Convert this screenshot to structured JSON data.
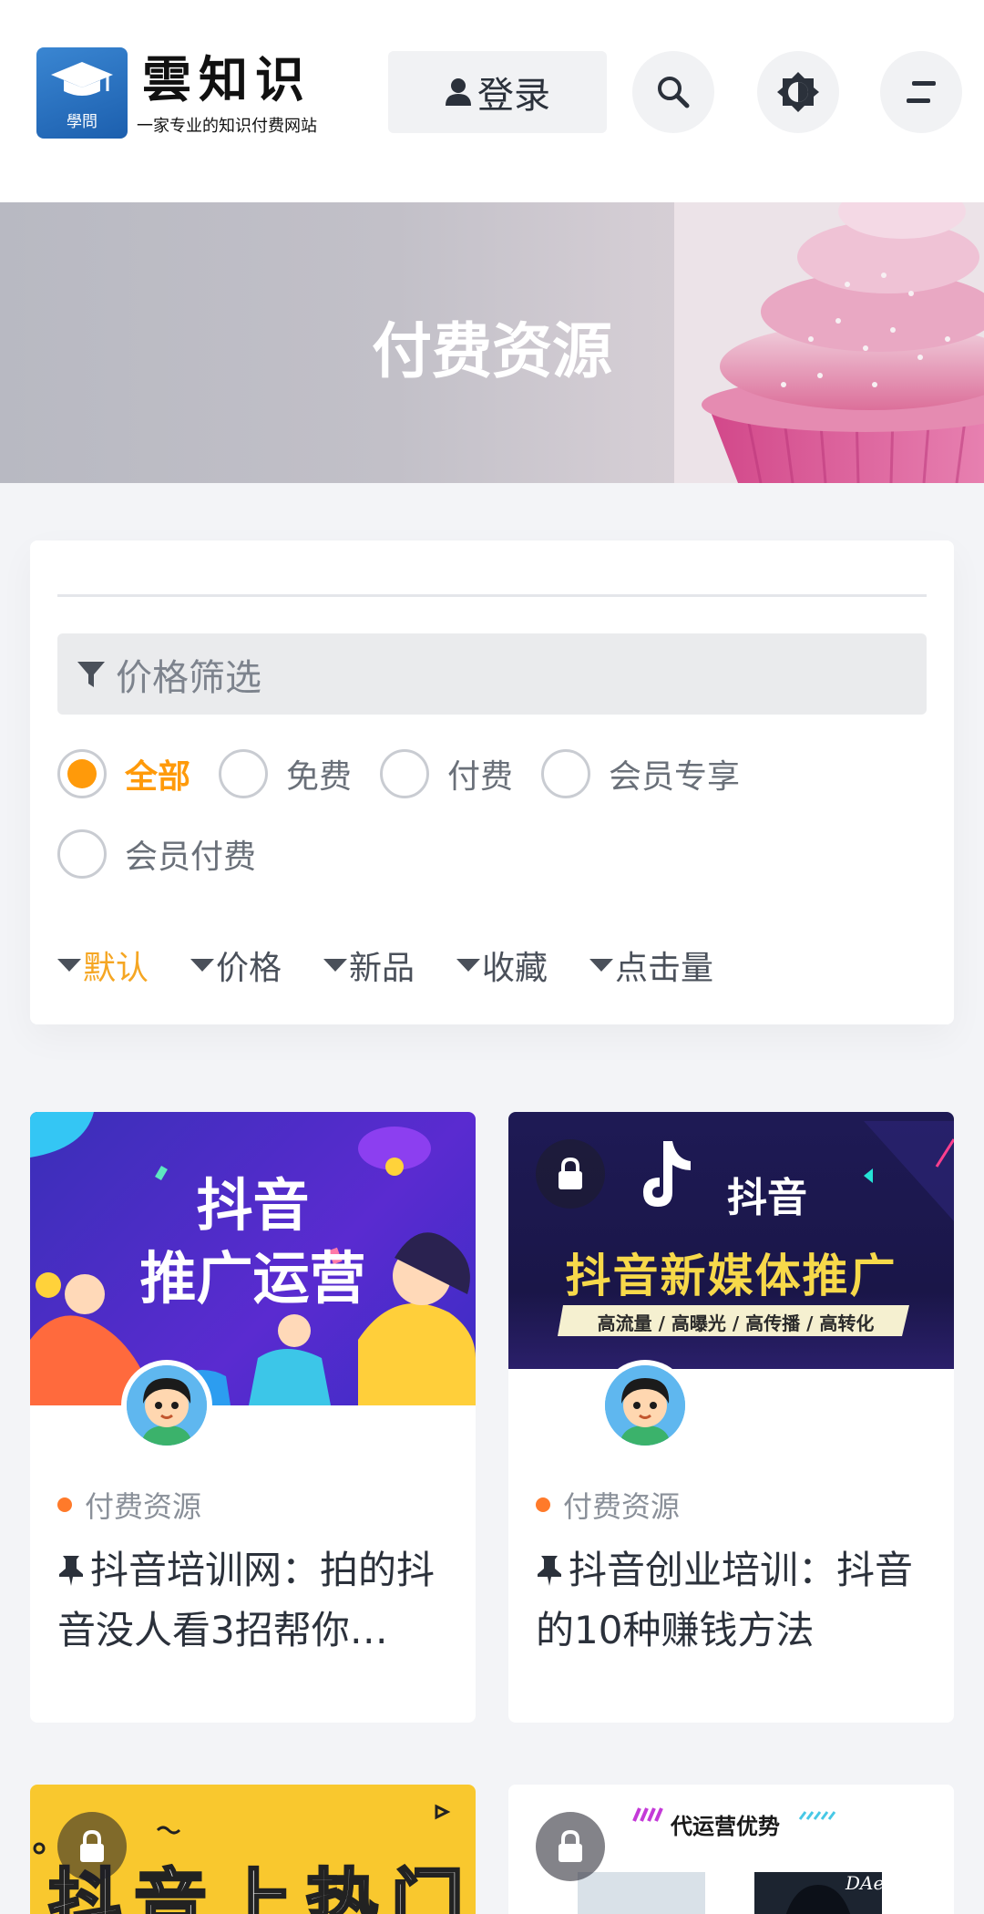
{
  "header": {
    "logo_icon": "graduation-cap-icon",
    "logo_badge_text": "學問",
    "brand_name": "雲知识",
    "brand_slogan": "一家专业的知识付费网站",
    "login_label": "登录",
    "search_icon": "search-icon",
    "theme_icon": "theme-toggle-icon",
    "menu_icon": "menu-icon"
  },
  "banner": {
    "title": "付费资源"
  },
  "filter": {
    "price_filter_label": "价格筛选",
    "options": [
      "全部",
      "免费",
      "付费",
      "会员专享",
      "会员付费"
    ],
    "selected_option": "全部",
    "sort": [
      "默认",
      "价格",
      "新品",
      "收藏",
      "点击量"
    ],
    "active_sort": "默认",
    "accent_color": "#ff9a0a"
  },
  "cards": [
    {
      "thumb_line1": "抖音",
      "thumb_line2": "推广运营",
      "category": "付费资源",
      "title": "抖音培训网：拍的抖音没人看3招帮你…",
      "locked": false
    },
    {
      "thumb_brand": "抖音",
      "thumb_headline": "抖音新媒体推广",
      "thumb_tags": "高流量 / 高曝光 / 高传播 / 高转化",
      "category": "付费资源",
      "title": "抖音创业培训：抖音的10种赚钱方法",
      "locked": true
    },
    {
      "thumb_line1": "抖音上热门",
      "locked": true
    },
    {
      "thumb_headline": "代运营优势",
      "thumb_brand_small": "DAer",
      "locked": true
    }
  ]
}
